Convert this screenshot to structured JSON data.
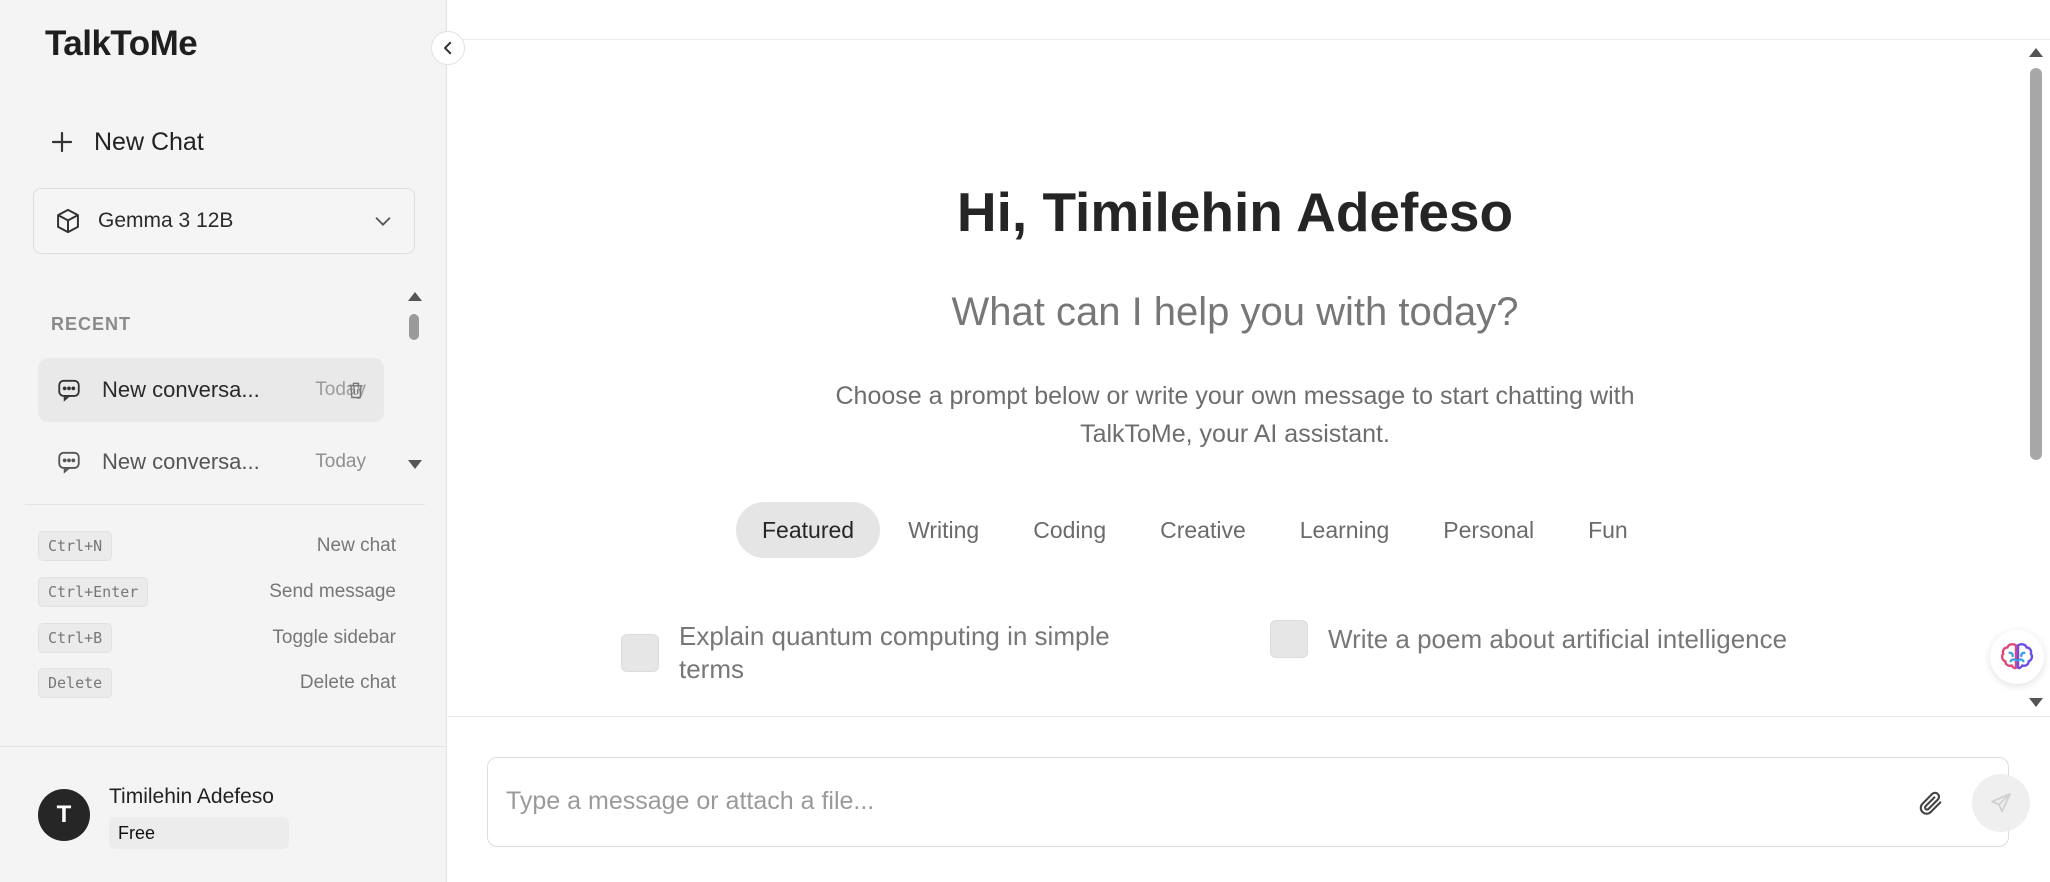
{
  "app": {
    "title": "TalkToMe"
  },
  "sidebar": {
    "new_chat_label": "New Chat",
    "model": {
      "selected": "Gemma 3 12B",
      "icon": "cube-icon"
    },
    "recent_label": "RECENT",
    "conversations": [
      {
        "name": "New conversa...",
        "date": "Today",
        "active": true
      },
      {
        "name": "New conversa...",
        "date": "Today",
        "active": false
      }
    ],
    "shortcuts": [
      {
        "key": "Ctrl+N",
        "label": "New chat"
      },
      {
        "key": "Ctrl+Enter",
        "label": "Send message"
      },
      {
        "key": "Ctrl+B",
        "label": "Toggle sidebar"
      },
      {
        "key": "Delete",
        "label": "Delete chat"
      }
    ],
    "user": {
      "initial": "T",
      "name": "Timilehin Adefeso",
      "plan": "Free"
    }
  },
  "main": {
    "greeting": "Hi, Timilehin Adefeso",
    "subtitle": "What can I help you with today?",
    "intro": "Choose a prompt below or write your own message to start chatting with TalkToMe, your AI assistant.",
    "tabs": [
      "Featured",
      "Writing",
      "Coding",
      "Creative",
      "Learning",
      "Personal",
      "Fun"
    ],
    "active_tab": "Featured",
    "prompts": [
      "Explain quantum computing in simple terms",
      "Write a poem about artificial intelligence"
    ]
  },
  "composer": {
    "placeholder": "Type a message or attach a file..."
  },
  "colors": {
    "sidebar_bg": "#f4f4f4",
    "active_tab_bg": "#e5e5e5",
    "avatar_bg": "#262626"
  }
}
